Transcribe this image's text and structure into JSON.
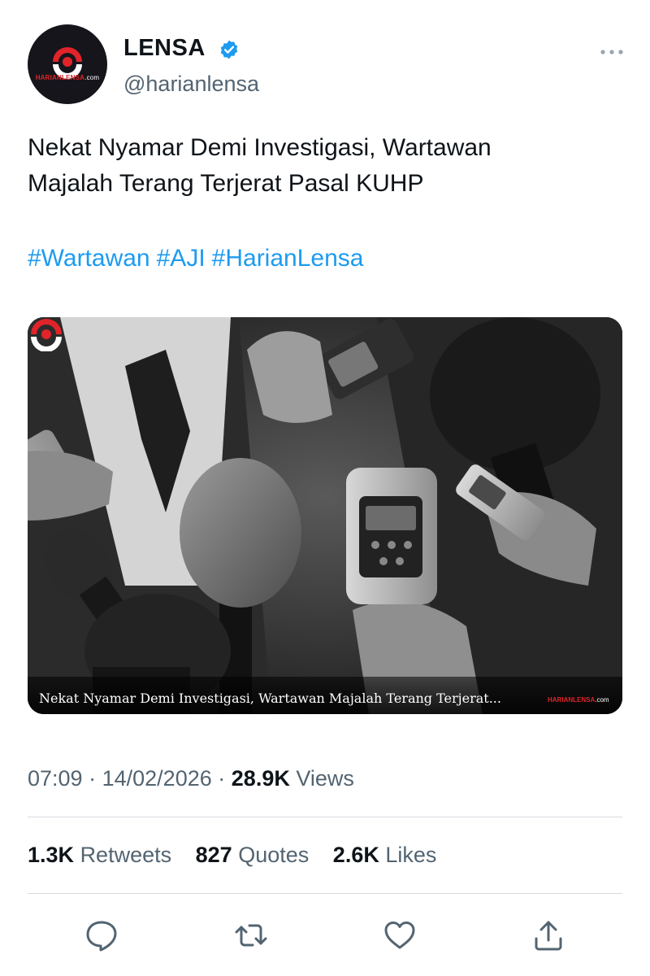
{
  "author": {
    "display_name": "LENSA",
    "handle": "@harianlensa",
    "logo_text_main": "HARIANLENSA",
    "logo_text_suffix": ".com",
    "verified": true,
    "brand_color": "#e0242a"
  },
  "tweet": {
    "text_line1": "Nekat Nyamar Demi Investigasi, Wartawan",
    "text_line2": "Majalah Terang Terjerat Pasal KUHP",
    "hashtags": [
      "#Wartawan",
      "#AJI",
      "#HarianLensa"
    ],
    "hashtag_color": "#1d9bf0"
  },
  "media": {
    "caption": "Nekat Nyamar Demi Investigasi, Wartawan Majalah Terang Terjerat...",
    "watermark_main": "HARIANLENSA",
    "watermark_suffix": ".com"
  },
  "meta": {
    "time": "07:09",
    "separator": "·",
    "date": "14/02/2026",
    "views_count": "28.9K",
    "views_label": "Views"
  },
  "stats": {
    "retweets_count": "1.3K",
    "retweets_label": "Retweets",
    "quotes_count": "827",
    "quotes_label": "Quotes",
    "likes_count": "2.6K",
    "likes_label": "Likes"
  },
  "actions": [
    "reply-icon",
    "retweet-icon",
    "like-icon",
    "share-icon"
  ],
  "icons": {
    "more": "more-horizontal-icon",
    "verified": "verified-badge-icon"
  }
}
